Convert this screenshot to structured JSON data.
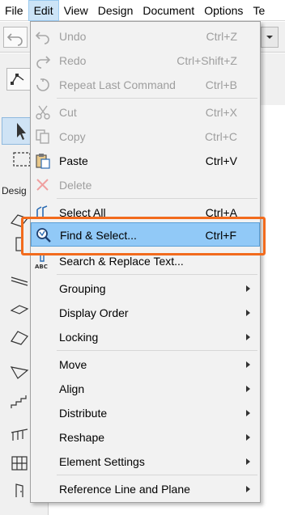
{
  "menubar": {
    "items": [
      {
        "label": "File"
      },
      {
        "label": "Edit",
        "active": true
      },
      {
        "label": "View"
      },
      {
        "label": "Design"
      },
      {
        "label": "Document"
      },
      {
        "label": "Options"
      },
      {
        "label": "Te"
      }
    ]
  },
  "toolbox": {
    "design_label": "Desig"
  },
  "edit_menu": {
    "items": [
      {
        "label": "Undo",
        "shortcut": "Ctrl+Z",
        "enabled": false,
        "icon": "undo-icon"
      },
      {
        "label": "Redo",
        "shortcut": "Ctrl+Shift+Z",
        "enabled": false,
        "icon": "redo-icon"
      },
      {
        "label": "Repeat Last Command",
        "shortcut": "Ctrl+B",
        "enabled": false,
        "icon": "repeat-icon"
      },
      {
        "label": "Cut",
        "shortcut": "Ctrl+X",
        "enabled": false,
        "icon": "scissors-icon"
      },
      {
        "label": "Copy",
        "shortcut": "Ctrl+C",
        "enabled": false,
        "icon": "copy-icon"
      },
      {
        "label": "Paste",
        "shortcut": "Ctrl+V",
        "enabled": true,
        "icon": "paste-icon"
      },
      {
        "label": "Delete",
        "shortcut": "",
        "enabled": false,
        "icon": "delete-x-icon"
      },
      {
        "label": "Select All",
        "shortcut": "Ctrl+A",
        "enabled": true,
        "icon": "select-all-icon"
      },
      {
        "label": "Find & Select...",
        "shortcut": "Ctrl+F",
        "enabled": true,
        "highlighted": true,
        "icon": "find-select-icon"
      },
      {
        "label": "Search & Replace Text...",
        "shortcut": "",
        "enabled": true,
        "icon": "search-replace-text-icon"
      },
      {
        "label": "Grouping",
        "submenu": true
      },
      {
        "label": "Display Order",
        "submenu": true
      },
      {
        "label": "Locking",
        "submenu": true
      },
      {
        "label": "Move",
        "submenu": true
      },
      {
        "label": "Align",
        "submenu": true
      },
      {
        "label": "Distribute",
        "submenu": true
      },
      {
        "label": "Reshape",
        "submenu": true
      },
      {
        "label": "Element Settings",
        "submenu": true
      },
      {
        "label": "Reference Line and Plane",
        "submenu": true
      }
    ]
  },
  "colors": {
    "highlight": "#91c9f7",
    "callout": "#f26b1d",
    "disabled_text": "#9e9e9e"
  }
}
